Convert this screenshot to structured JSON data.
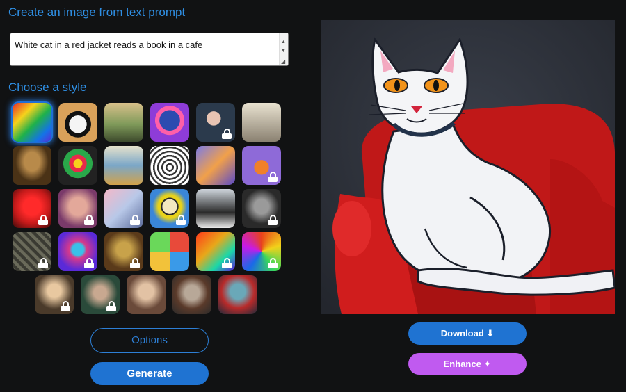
{
  "header": {
    "title": "Create an image from text prompt"
  },
  "prompt": {
    "value": "White cat in a red jacket reads a book in a cafe"
  },
  "styles": {
    "title": "Choose a style"
  },
  "buttons": {
    "options": "Options",
    "generate": "Generate",
    "download": "Download ⬇",
    "enhance": "Enhance ✦"
  },
  "colors": {
    "accent": "#2f8fe4",
    "primary_button": "#1f73d2",
    "enhance_button": "#c05af0",
    "background": "#111213"
  },
  "tiles": [
    {
      "name": "style-abstract-colorful",
      "locked": false,
      "selected": true
    },
    {
      "name": "style-panda",
      "locked": false
    },
    {
      "name": "style-landscape-painting",
      "locked": false
    },
    {
      "name": "style-robot",
      "locked": false
    },
    {
      "name": "style-portrait-woman",
      "locked": true
    },
    {
      "name": "style-vintage-photo",
      "locked": false
    },
    {
      "name": "style-renaissance",
      "locked": false
    },
    {
      "name": "style-flowers",
      "locked": false
    },
    {
      "name": "style-ballet-dancers",
      "locked": false
    },
    {
      "name": "style-sketch-cup",
      "locked": false
    },
    {
      "name": "style-isometric",
      "locked": false
    },
    {
      "name": "style-fox-lowpoly",
      "locked": true
    },
    {
      "name": "style-red-face",
      "locked": true
    },
    {
      "name": "style-blur-portrait",
      "locked": true
    },
    {
      "name": "style-pastel",
      "locked": true
    },
    {
      "name": "style-pop-art",
      "locked": true
    },
    {
      "name": "style-architecture",
      "locked": false
    },
    {
      "name": "style-dark-sculpture",
      "locked": true
    },
    {
      "name": "style-stone-mosaic",
      "locked": true
    },
    {
      "name": "style-colorful-portrait",
      "locked": true
    },
    {
      "name": "style-golden-painting",
      "locked": true
    },
    {
      "name": "style-icon-grid",
      "locked": false
    },
    {
      "name": "style-neon-dragon",
      "locked": true
    },
    {
      "name": "style-psychedelic",
      "locked": true
    },
    {
      "name": "style-fantasy-warrior",
      "locked": true
    },
    {
      "name": "style-forest-portrait",
      "locked": true
    },
    {
      "name": "style-classic-portrait",
      "locked": false
    },
    {
      "name": "style-steampunk",
      "locked": false
    },
    {
      "name": "style-fantasy-elf",
      "locked": false
    }
  ]
}
